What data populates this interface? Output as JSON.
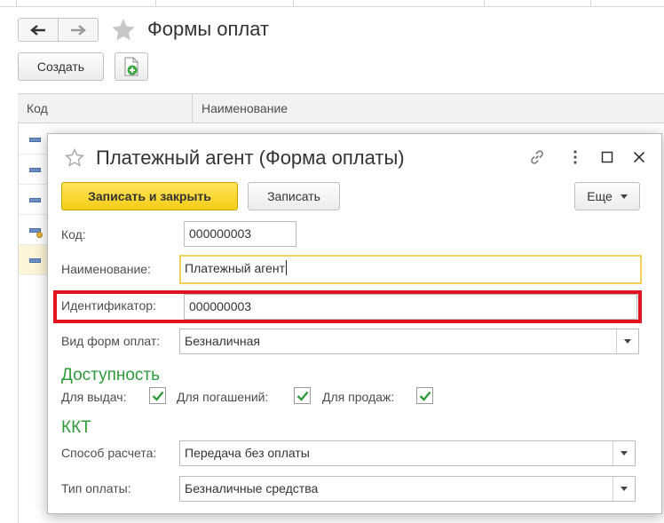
{
  "list_window": {
    "title": "Формы оплат",
    "create_label": "Создать",
    "columns": {
      "code": "Код",
      "name": "Наименование"
    }
  },
  "dialog": {
    "title": "Платежный агент (Форма оплаты)",
    "toolbar": {
      "save_close_label": "Записать и закрыть",
      "save_label": "Записать",
      "more_label": "Еще"
    },
    "fields": {
      "code_label": "Код:",
      "code_value": "000000003",
      "name_label": "Наименование:",
      "name_value": "Платежный агент",
      "id_label": "Идентификатор:",
      "id_value": "000000003",
      "payment_type_label": "Вид форм оплат:",
      "payment_type_value": "Безналичная"
    },
    "availability": {
      "heading": "Доступность",
      "issue_label": "Для выдач:",
      "issue_checked": true,
      "repay_label": "Для погашений:",
      "repay_checked": true,
      "sale_label": "Для продаж:",
      "sale_checked": true
    },
    "kkt": {
      "heading": "ККТ",
      "calc_method_label": "Способ расчета:",
      "calc_method_value": "Передача без оплаты",
      "payment_kind_label": "Тип оплаты:",
      "payment_kind_value": "Безналичные средства"
    }
  },
  "colors": {
    "accent_yellow": "#f5cc18",
    "section_green": "#2e9a3b",
    "highlight_red": "#e0141e",
    "selected_row": "#fbf6d9"
  }
}
